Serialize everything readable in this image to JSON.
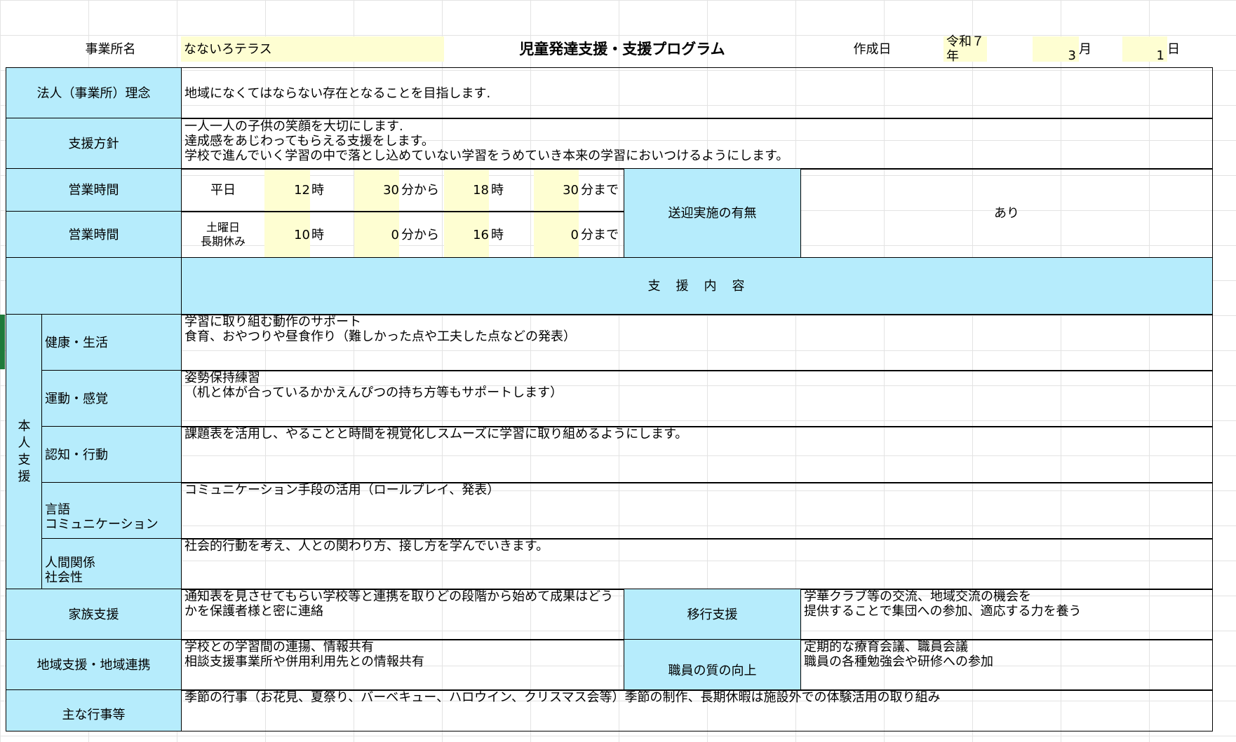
{
  "header": {
    "office_label": "事業所名",
    "office_name": "なないろテラス",
    "title": "児童発達支援・支援プログラム",
    "created_label": "作成日",
    "era_year": "令和７年",
    "month": "3",
    "month_unit": "月",
    "day": "1",
    "day_unit": "日"
  },
  "philosophy": {
    "label": "法人（事業所）理念",
    "text": "地域になくてはならない存在となることを目指します."
  },
  "policy": {
    "label": "支援方針",
    "text": "一人一人の子供の笑顔を大切にします.\n達成感をあじわってもらえる支援をします。\n学校で進んでいく学習の中で落とし込めていない学習をうめていき本来の学習においつけるようにします。"
  },
  "hours": {
    "label": "営業時間",
    "weekday": {
      "day": "平日",
      "start_h": "12",
      "h_unit": "時",
      "start_m": "30",
      "from": "分から",
      "end_h": "18",
      "end_m": "30",
      "to": "分まで"
    },
    "holiday": {
      "day": "土曜日\n長期休み",
      "start_h": "10",
      "h_unit": "時",
      "start_m": "0",
      "from": "分から",
      "end_h": "16",
      "end_m": "0",
      "to": "分まで"
    }
  },
  "transport": {
    "label": "送迎実施の有無",
    "value": "あり"
  },
  "support_header": "支　援　内　容",
  "self_support": {
    "label": "本\n人\n支\n援",
    "rows": [
      {
        "label": "健康・生活",
        "text": "学習に取り組む動作のサポート\n食育、おやつりや昼食作り（難しかった点や工夫した点などの発表）"
      },
      {
        "label": "運動・感覚",
        "text": "姿勢保持練習\n（机と体が合っているかかえんぴつの持ち方等もサポートします）"
      },
      {
        "label": "認知・行動",
        "text": "課題表を活用し、やることと時間を視覚化しスムーズに学習に取り組めるようにします。"
      },
      {
        "label": "言語\nコミュニケーション",
        "text": "コミュニケーション手段の活用（ロールプレイ、発表）"
      },
      {
        "label": "人間関係\n社会性",
        "text": "社会的行動を考え、人との関わり方、接し方を学んでいきます。"
      }
    ]
  },
  "family": {
    "label": "家族支援",
    "text": "通知表を見させてもらい学校等と連携を取りどの段階から始めて成果はどう\nかを保護者様と密に連絡"
  },
  "transition": {
    "label": "移行支援",
    "text": "学華クラブ等の交流、地域交流の機会を\n提供することで集団への参加、適応する力を養う"
  },
  "community": {
    "label": "地域支援・地域連携",
    "text": "学校との学習間の連揚、情報共有\n相談支援事業所や併用利用先との情報共有"
  },
  "staff": {
    "label": "職員の質の向上",
    "text": "定期的な療育会議、職員会議\n職員の各種勉強会や研修への参加"
  },
  "events": {
    "label": "主な行事等",
    "text": "季節の行事（お花見、夏祭り、バーベキュー、ハロウイン、クリスマス会等）季節の制作、長期休暇は施設外での体験活用の取り組み"
  },
  "colors": {
    "label_bg": "#b6ecfc",
    "input_bg": "#fefed2",
    "border": "#000000",
    "gridline": "#e3e3e3"
  }
}
